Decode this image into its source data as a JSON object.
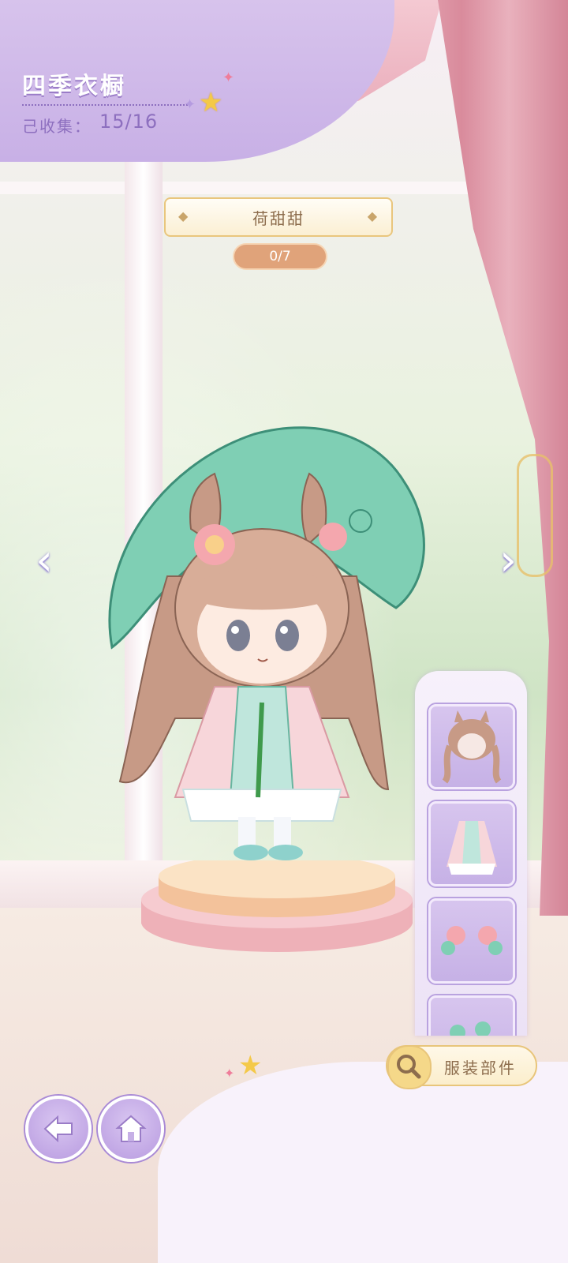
{
  "header": {
    "title": "四季衣橱",
    "collected_label": "己收集：",
    "collected_value": "15/16"
  },
  "outfit": {
    "name": "荷甜甜",
    "progress": "0/7"
  },
  "nav": {
    "prev_icon": "chevron-left-icon",
    "next_icon": "chevron-right-icon"
  },
  "parts_panel": {
    "slots": [
      {
        "icon": "hair-icon"
      },
      {
        "icon": "dress-icon"
      },
      {
        "icon": "hair-accessory-icon"
      },
      {
        "icon": "accessory-icon"
      }
    ]
  },
  "parts_button": {
    "label": "服装部件",
    "icon": "magnifier-icon"
  },
  "bottom_nav": {
    "back_icon": "back-arrow-icon",
    "home_icon": "home-icon"
  },
  "colors": {
    "header": "#c8b0e6",
    "accent_gold": "#e8c57a",
    "progress_pill": "#e0a37a",
    "curtain": "#e6a9b6"
  }
}
